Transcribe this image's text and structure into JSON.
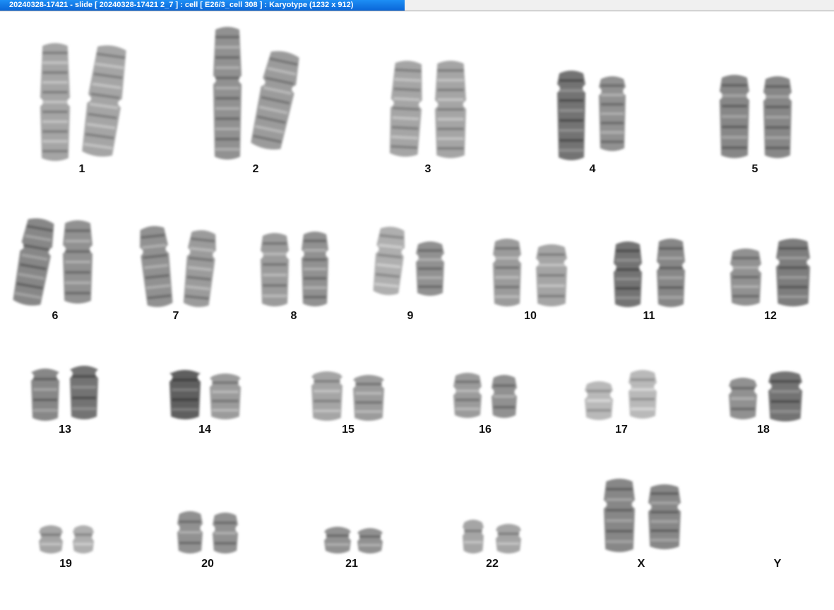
{
  "window": {
    "title": "20240328-17421 - slide [ 20240328-17421 2_7 ] : cell [ E26/3_cell 308 ] : Karyotype  (1232 x 912)"
  },
  "karyotype": {
    "chromosomes": [
      {
        "label": "1"
      },
      {
        "label": "2"
      },
      {
        "label": "3"
      },
      {
        "label": "4"
      },
      {
        "label": "5"
      },
      {
        "label": "6"
      },
      {
        "label": "7"
      },
      {
        "label": "8"
      },
      {
        "label": "9"
      },
      {
        "label": "10"
      },
      {
        "label": "11"
      },
      {
        "label": "12"
      },
      {
        "label": "13"
      },
      {
        "label": "14"
      },
      {
        "label": "15"
      },
      {
        "label": "16"
      },
      {
        "label": "17"
      },
      {
        "label": "18"
      },
      {
        "label": "19"
      },
      {
        "label": "20"
      },
      {
        "label": "21"
      },
      {
        "label": "22"
      },
      {
        "label": "X"
      },
      {
        "label": "Y"
      }
    ]
  }
}
